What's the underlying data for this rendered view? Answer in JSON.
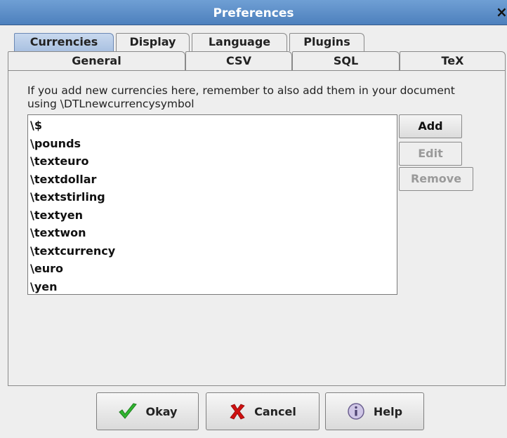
{
  "window": {
    "title": "Preferences",
    "close_glyph": "×"
  },
  "tabs_row1": [
    {
      "label": "Currencies",
      "selected": true
    },
    {
      "label": "Display"
    },
    {
      "label": "Language"
    },
    {
      "label": "Plugins"
    }
  ],
  "tabs_row2": [
    {
      "label": "General"
    },
    {
      "label": "CSV"
    },
    {
      "label": "SQL"
    },
    {
      "label": "TeX"
    }
  ],
  "info_text": "If you add new currencies here, remember to also add them in your document using \\DTLnewcurrencysymbol",
  "currencies": [
    "\\$",
    "\\pounds",
    "\\texteuro",
    "\\textdollar",
    "\\textstirling",
    "\\textyen",
    "\\textwon",
    "\\textcurrency",
    "\\euro",
    "\\yen"
  ],
  "side_buttons": {
    "add": "Add",
    "edit": "Edit",
    "remove": "Remove"
  },
  "bottom_buttons": {
    "okay": "Okay",
    "cancel": "Cancel",
    "help": "Help"
  },
  "colors": {
    "titlebar": "#5a8cc8",
    "selected_tab": "#b4c9e6",
    "okay_icon": "#2fb52f",
    "cancel_icon": "#d01010"
  },
  "icons": {
    "okay": "check-icon",
    "cancel": "x-mark-icon",
    "help": "info-icon",
    "close": "close-icon"
  }
}
